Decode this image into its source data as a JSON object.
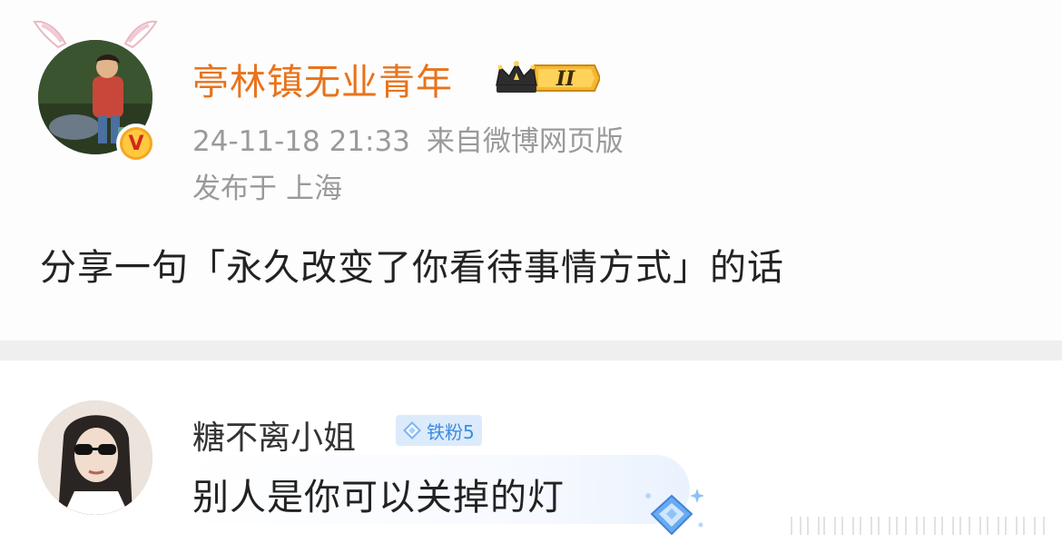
{
  "post": {
    "author_name": "亭林镇无业青年",
    "member_level": "II",
    "timestamp": "24-11-18 21:33",
    "source": "来自微博网页版",
    "location_prefix": "发布于",
    "location": "上海",
    "text": "分享一句「永久改变了你看待事情方式」的话",
    "verified_mark": "V"
  },
  "comment": {
    "author_name": "糖不离小姐",
    "fan_badge": "铁粉5",
    "text": "别人是你可以关掉的灯"
  },
  "colors": {
    "author_name": "#e8731c",
    "meta_text": "#9a9a9a",
    "fan_badge_bg": "#dcebfb",
    "fan_badge_text": "#3d8be0",
    "divider": "#efefef"
  },
  "icons": {
    "avatar_decoration": "bunny-ears-icon",
    "member_badge": "crown-icon",
    "verified": "verified-v-icon",
    "fan_badge": "diamond-icon",
    "comment_decoration": "gem-sparkle-icon"
  }
}
